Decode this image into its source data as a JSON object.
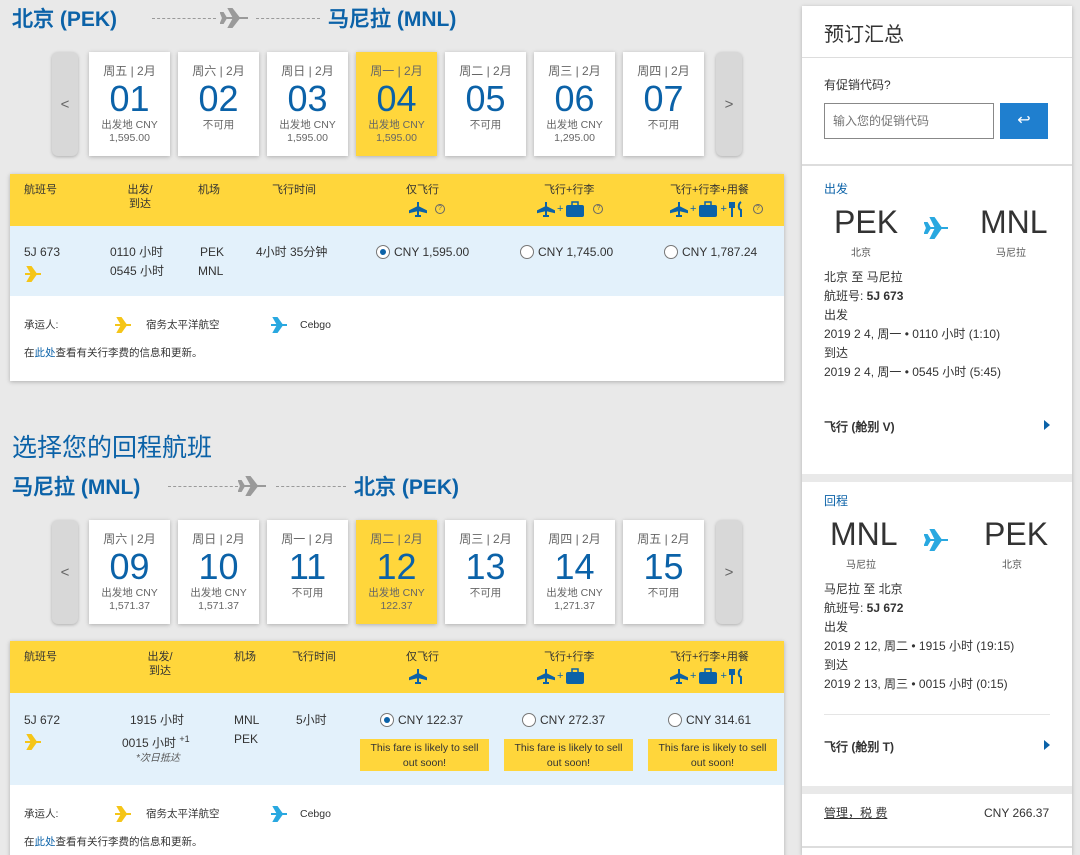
{
  "outbound": {
    "from": "北京 (PEK)",
    "to": "马尼拉 (MNL)",
    "dates": [
      {
        "dow": "周五 | 2月",
        "num": "01",
        "label": "出发地 CNY",
        "price": "1,595.00",
        "selected": false
      },
      {
        "dow": "周六 | 2月",
        "num": "02",
        "label": "不可用",
        "price": "",
        "selected": false
      },
      {
        "dow": "周日 | 2月",
        "num": "03",
        "label": "出发地 CNY",
        "price": "1,595.00",
        "selected": false
      },
      {
        "dow": "周一 | 2月",
        "num": "04",
        "label": "出发地 CNY",
        "price": "1,595.00",
        "selected": true
      },
      {
        "dow": "周二 | 2月",
        "num": "05",
        "label": "不可用",
        "price": "",
        "selected": false
      },
      {
        "dow": "周三 | 2月",
        "num": "06",
        "label": "出发地 CNY",
        "price": "1,295.00",
        "selected": false
      },
      {
        "dow": "周四 | 2月",
        "num": "07",
        "label": "不可用",
        "price": "",
        "selected": false
      }
    ],
    "flight": {
      "number": "5J 673",
      "dep_time": "0110 小时",
      "arr_time": "0545 小时",
      "airport_from": "PEK",
      "airport_to": "MNL",
      "duration": "4小时 35分钟",
      "fare_fly": "CNY 1,595.00",
      "fare_bag": "CNY 1,745.00",
      "fare_meal": "CNY 1,787.24",
      "selected_fare": "fly"
    }
  },
  "table_headers": {
    "flight_no": "航班号",
    "depart_arrive_1": "出发/",
    "depart_arrive_2": "到达",
    "airport": "机场",
    "duration": "飞行时间",
    "fly_only": "仅飞行",
    "fly_bag": "飞行+行李",
    "fly_bag_meal": "飞行+行李+用餐"
  },
  "footer": {
    "carrier_label": "承运人:",
    "carrier_1": "宿务太平洋航空",
    "carrier_2": "Cebgo",
    "info_prefix": "在",
    "info_link": "此处",
    "info_suffix": "查看有关行李费的信息和更新。"
  },
  "return_title": "选择您的回程航班",
  "inbound": {
    "from": "马尼拉 (MNL)",
    "to": "北京 (PEK)",
    "dates": [
      {
        "dow": "周六 | 2月",
        "num": "09",
        "label": "出发地 CNY",
        "price": "1,571.37",
        "selected": false
      },
      {
        "dow": "周日 | 2月",
        "num": "10",
        "label": "出发地 CNY",
        "price": "1,571.37",
        "selected": false
      },
      {
        "dow": "周一 | 2月",
        "num": "11",
        "label": "不可用",
        "price": "",
        "selected": false
      },
      {
        "dow": "周二 | 2月",
        "num": "12",
        "label": "出发地 CNY",
        "price": "122.37",
        "selected": true
      },
      {
        "dow": "周三 | 2月",
        "num": "13",
        "label": "不可用",
        "price": "",
        "selected": false
      },
      {
        "dow": "周四 | 2月",
        "num": "14",
        "label": "出发地 CNY",
        "price": "1,271.37",
        "selected": false
      },
      {
        "dow": "周五 | 2月",
        "num": "15",
        "label": "不可用",
        "price": "",
        "selected": false
      }
    ],
    "flight": {
      "number": "5J 672",
      "dep_time": "1915 小时",
      "arr_time": "0015 小时",
      "arr_sup": "+1",
      "next_day": "*次日抵达",
      "airport_from": "MNL",
      "airport_to": "PEK",
      "duration": "5小时",
      "fare_fly": "CNY 122.37",
      "fare_bag": "CNY 272.37",
      "fare_meal": "CNY 314.61",
      "selected_fare": "fly",
      "sell_out_1": "This fare is likely to sell",
      "sell_out_2": "out soon!"
    }
  },
  "summary": {
    "title": "预订汇总",
    "promo_label": "有促销代码?",
    "promo_placeholder": "输入您的促销代码",
    "promo_button": "↩",
    "out": {
      "heading": "出发",
      "from_code": "PEK",
      "from_city": "北京",
      "to_code": "MNL",
      "to_city": "马尼拉",
      "route": "北京 至 马尼拉",
      "flight_label": "航班号: ",
      "flight_no": "5J 673",
      "dep_label": "出发",
      "dep": "2019 2 4, 周一 • 0110 小时 (1:10)",
      "arr_label": "到达",
      "arr": "2019 2 4, 周一 • 0545 小时 (5:45)",
      "fare_class": "飞行 (舱别 V)"
    },
    "ret": {
      "heading": "回程",
      "from_code": "MNL",
      "from_city": "马尼拉",
      "to_code": "PEK",
      "to_city": "北京",
      "route": "马尼拉 至 北京",
      "flight_label": "航班号: ",
      "flight_no": "5J 672",
      "dep_label": "出发",
      "dep": "2019 2 12, 周二 • 1915 小时 (19:15)",
      "arr_label": "到达",
      "arr": "2019 2 13, 周三 • 0015 小时 (0:15)",
      "fare_class": "飞行 (舱别 T)"
    },
    "fees_label": "管理，税 费",
    "fees_value": "CNY 266.37"
  },
  "colors": {
    "brand_blue": "#0b62a8",
    "accent_yellow": "#ffd63b",
    "light_blue_row": "#e3f1fb",
    "plane_blue": "#29a8e0"
  }
}
